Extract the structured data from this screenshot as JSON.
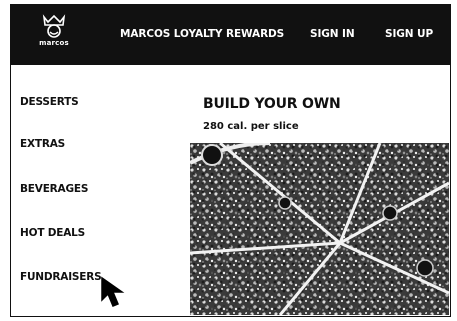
{
  "header": {
    "logo_text": "marcos",
    "nav": {
      "loyalty": "MARCOS LOYALTY REWARDS",
      "signin": "SIGN IN",
      "signup": "SIGN UP"
    }
  },
  "sidebar": {
    "items": [
      {
        "label": "DESSERTS"
      },
      {
        "label": "EXTRAS"
      },
      {
        "label": "BEVERAGES"
      },
      {
        "label": "HOT DEALS"
      },
      {
        "label": "FUNDRAISERS"
      }
    ]
  },
  "main": {
    "title": "BUILD YOUR OWN",
    "calories": "280 cal. per slice"
  }
}
